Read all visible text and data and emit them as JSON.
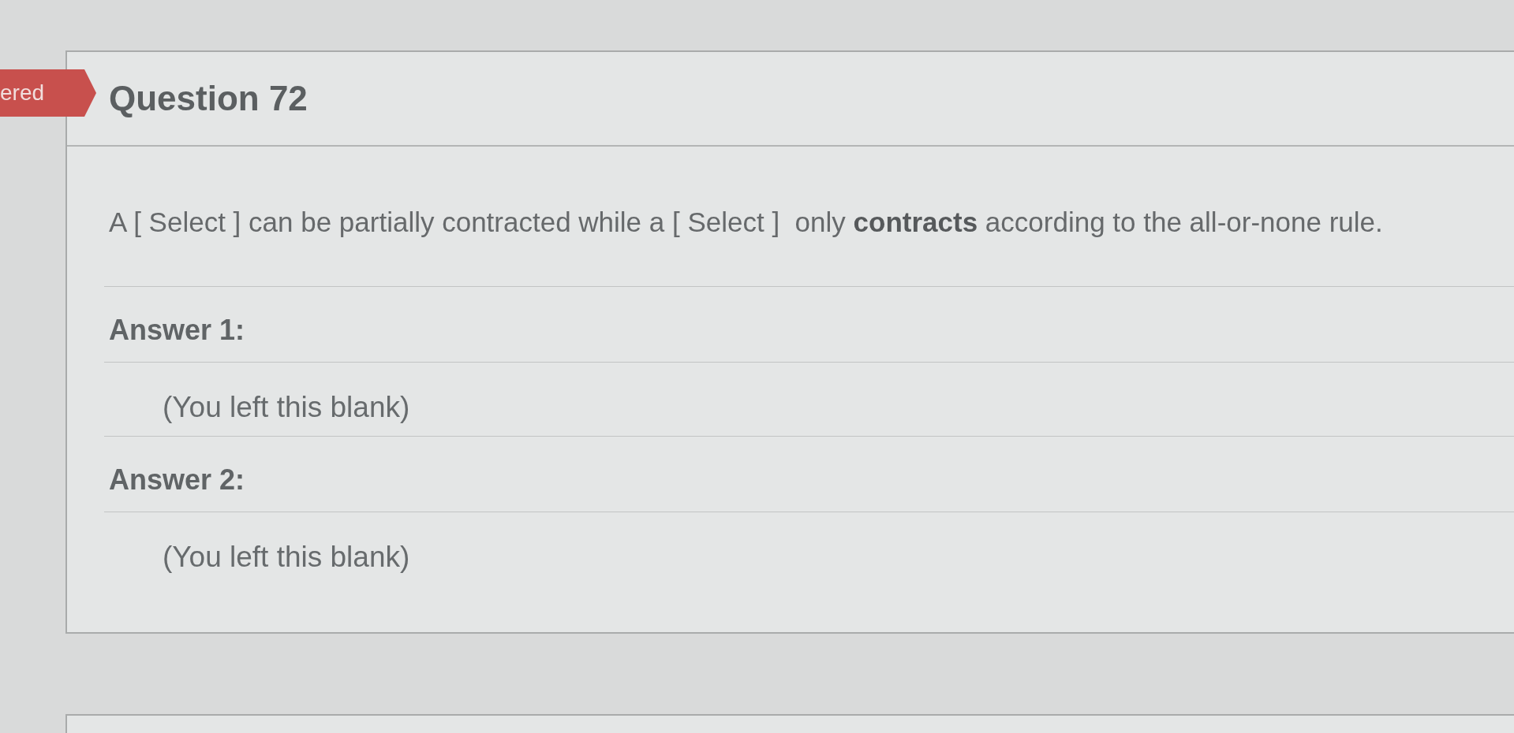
{
  "status_banner": {
    "text": "ered"
  },
  "question": {
    "title": "Question 72",
    "text": "A [ Select ] can be partially contracted while a [ Select ]  only **contracts** according to the all-or-none rule."
  },
  "answers": [
    {
      "label": "Answer 1:",
      "response": "(You left this blank)"
    },
    {
      "label": "Answer 2:",
      "response": "(You left this blank)"
    }
  ]
}
